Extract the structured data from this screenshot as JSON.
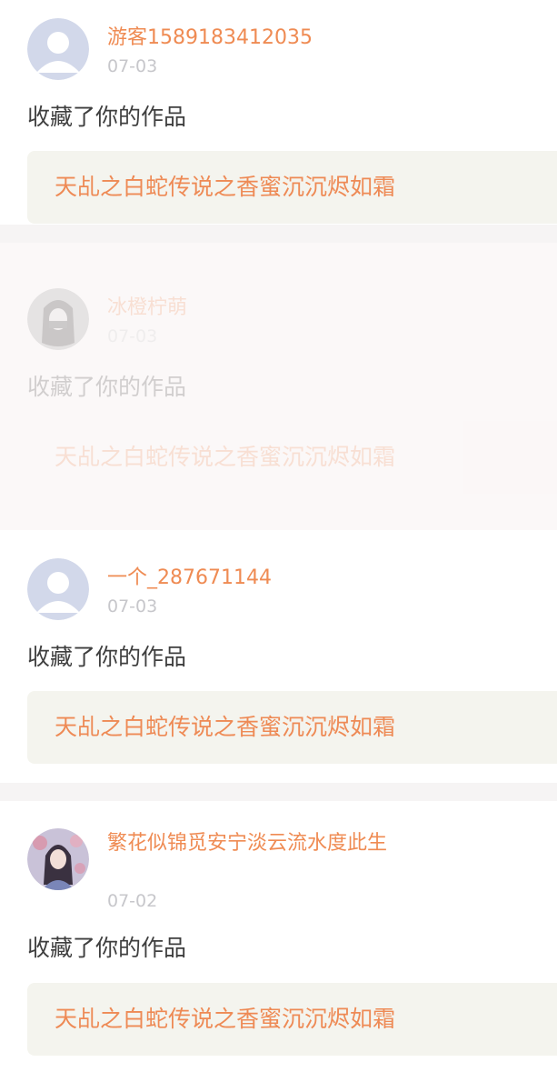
{
  "notifications": [
    {
      "user": "游客1589183412035",
      "date": "07-03",
      "action": "收藏了你的作品",
      "work": "天乩之白蛇传说之香蜜沉沉烬如霜",
      "avatar_icon": "default-user-avatar"
    },
    {
      "user": "冰橙柠萌",
      "date": "07-03",
      "action": "收藏了你的作品",
      "work": "天乩之白蛇传说之香蜜沉沉烬如霜",
      "avatar_icon": "photo-avatar-dark"
    },
    {
      "user": "一个_287671144",
      "date": "07-03",
      "action": "收藏了你的作品",
      "work": "天乩之白蛇传说之香蜜沉沉烬如霜",
      "avatar_icon": "default-user-avatar"
    },
    {
      "user": "繁花似锦觅安宁淡云流水度此生",
      "date": "07-02",
      "action": "收藏了你的作品",
      "work": "天乩之白蛇传说之香蜜沉沉烬如霜",
      "avatar_icon": "photo-avatar-character"
    }
  ],
  "colors": {
    "accent": "#ef8b53",
    "date": "#c7c7cb",
    "text": "#3f3f3f",
    "work_bg": "#f4f4ee"
  }
}
